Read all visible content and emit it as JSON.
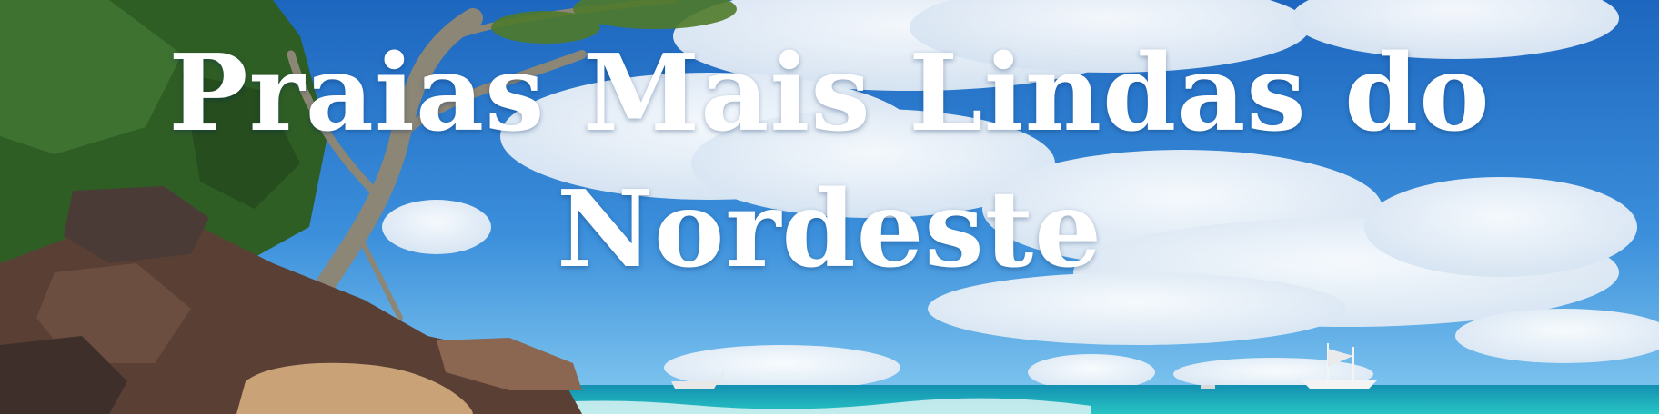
{
  "banner": {
    "title_line1": "Praias Mais Lindas do",
    "title_line2": "Nordeste"
  },
  "scene": {
    "sky_top": "#1f6fc6",
    "sky_bottom": "#6db8ea",
    "sea": "#1aa6b8",
    "foam": "#e8f8f8",
    "rock": "#5a4034",
    "sand": "#c9a277",
    "foliage": "#2f5e25",
    "tree_trunk": "#8c8676"
  }
}
